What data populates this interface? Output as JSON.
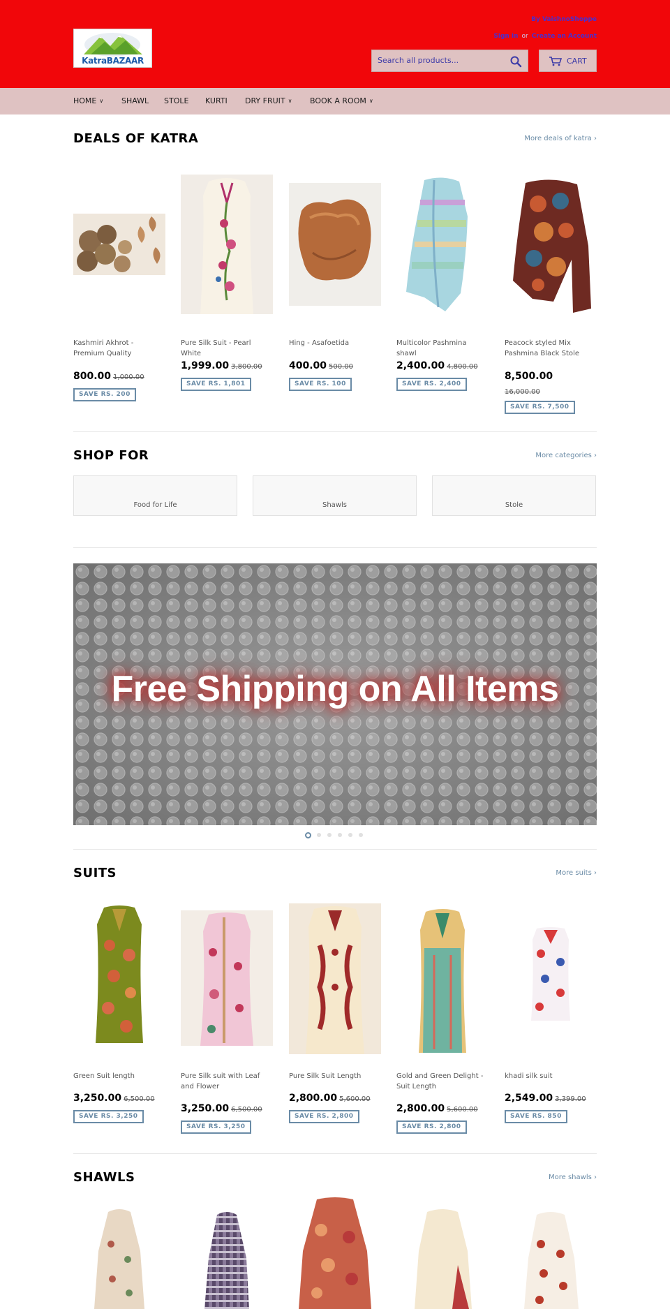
{
  "header": {
    "logo_text": "KatraBAZAAR",
    "byline": "By VaishnoShoppe",
    "sign_in": "Sign in",
    "or": "or",
    "create_account": "Create an Account",
    "search_placeholder": "Search all products...",
    "cart_label": "CART",
    "colors": {
      "header_bg": "#f1060a",
      "nav_bg": "#dfc2c2",
      "accent": "#6a8ba6",
      "link": "#4a2fd0"
    }
  },
  "nav": {
    "items": [
      {
        "label": "HOME",
        "has_dropdown": true
      },
      {
        "label": "SHAWL",
        "has_dropdown": false
      },
      {
        "label": "STOLE",
        "has_dropdown": false
      },
      {
        "label": "KURTI",
        "has_dropdown": false
      },
      {
        "label": "DRY FRUIT",
        "has_dropdown": true
      },
      {
        "label": "BOOK A ROOM",
        "has_dropdown": true
      }
    ]
  },
  "deals": {
    "title": "DEALS OF KATRA",
    "more": "More deals of katra ›",
    "products": [
      {
        "name": "Kashmiri Akhrot - Premium Quality",
        "price": "800.00",
        "was": "1,000.00",
        "save": "SAVE RS. 200",
        "image": "walnuts"
      },
      {
        "name": "Pure Silk Suit - Pearl White",
        "price": "1,999.00",
        "was": "3,800.00",
        "save": "SAVE RS. 1,801",
        "image": "white-suit"
      },
      {
        "name": "Hing - Asafoetida",
        "price": "400.00",
        "was": "500.00",
        "save": "SAVE RS. 100",
        "image": "hing-lump"
      },
      {
        "name": "Multicolor Pashmina shawl",
        "price": "2,400.00",
        "was": "4,800.00",
        "save": "SAVE RS. 2,400",
        "image": "multicolor-shawl"
      },
      {
        "name": "Peacock styled Mix Pashmina Black Stole",
        "price": "8,500.00",
        "was": "16,000.00",
        "save": "SAVE RS. 7,500",
        "image": "peacock-stole"
      }
    ]
  },
  "shop_for": {
    "title": "SHOP FOR",
    "more": "More categories ›",
    "categories": [
      "Food for Life",
      "Shawls",
      "Stole"
    ]
  },
  "banner": {
    "text": "Free Shipping on All Items",
    "slide_count": 6,
    "active_slide": 1
  },
  "suits": {
    "title": "SUITS",
    "more": "More suits ›",
    "products": [
      {
        "name": "Green Suit length",
        "price": "3,250.00",
        "was": "6,500.00",
        "save": "SAVE RS. 3,250",
        "image": "green-suit"
      },
      {
        "name": "Pure Silk suit with Leaf and Flower",
        "price": "3,250.00",
        "was": "6,500.00",
        "save": "SAVE RS. 3,250",
        "image": "pink-suit"
      },
      {
        "name": "Pure Silk Suit Length",
        "price": "2,800.00",
        "was": "5,600.00",
        "save": "SAVE RS. 2,800",
        "image": "cream-suit"
      },
      {
        "name": "Gold and Green Delight - Suit Length",
        "price": "2,800.00",
        "was": "5,600.00",
        "save": "SAVE RS. 2,800",
        "image": "gold-green-suit"
      },
      {
        "name": "khadi silk suit",
        "price": "2,549.00",
        "was": "3,399.00",
        "save": "SAVE RS. 850",
        "image": "khadi-suit"
      }
    ]
  },
  "shawls": {
    "title": "SHAWLS",
    "more": "More shawls ›"
  }
}
